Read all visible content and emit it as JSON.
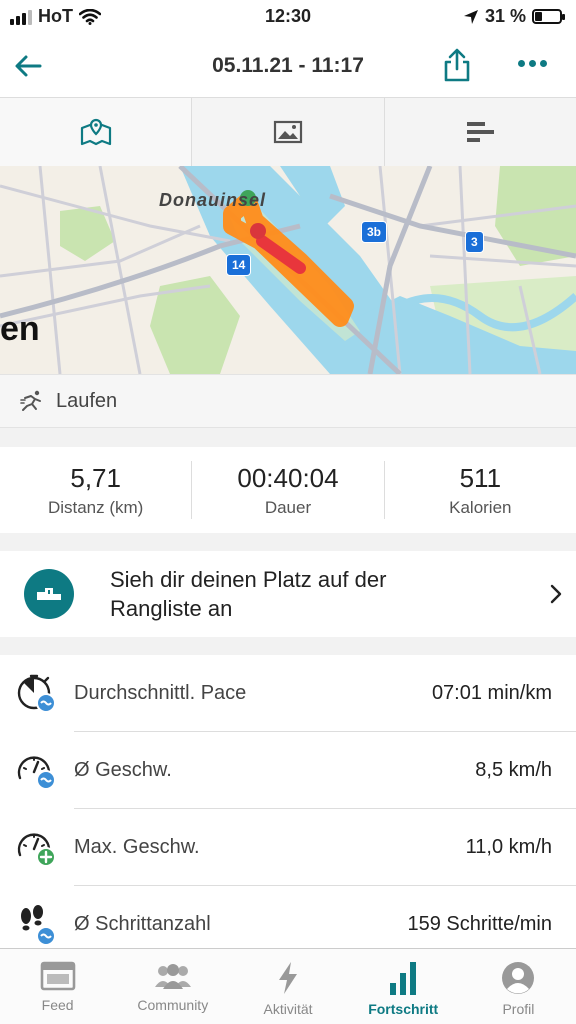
{
  "status_bar": {
    "carrier": "HoT",
    "time": "12:30",
    "battery": "31 %",
    "battery_level": 0.31
  },
  "header": {
    "title": "05.11.21 - 11:17"
  },
  "tabs": [
    {
      "icon": "map-icon",
      "active": true
    },
    {
      "icon": "photo-icon",
      "active": false
    },
    {
      "icon": "bar-chart-icon",
      "active": false
    }
  ],
  "map": {
    "place_label": "Donauinsel",
    "city_fragment": "en",
    "shields": [
      "3b",
      "3",
      "14"
    ]
  },
  "activity": {
    "icon": "running-icon",
    "name": "Laufen"
  },
  "stats": [
    {
      "value": "5,71",
      "label": "Distanz (km)"
    },
    {
      "value": "00:40:04",
      "label": "Dauer"
    },
    {
      "value": "511",
      "label": "Kalorien"
    }
  ],
  "leaderboard": {
    "text": "Sieh dir deinen Platz auf der Rangliste an"
  },
  "metrics": [
    {
      "icon": "stopwatch-icon",
      "name": "Durchschnittl. Pace",
      "value": "07:01 min/km"
    },
    {
      "icon": "speedometer-avg-icon",
      "name": "Ø Geschw.",
      "value": "8,5 km/h"
    },
    {
      "icon": "speedometer-max-icon",
      "name": "Max. Geschw.",
      "value": "11,0 km/h"
    },
    {
      "icon": "footsteps-icon",
      "name": "Ø Schrittanzahl",
      "value": "159 Schritte/min"
    }
  ],
  "tabbar": [
    {
      "label": "Feed",
      "icon": "feed-icon",
      "active": false
    },
    {
      "label": "Community",
      "icon": "community-icon",
      "active": false
    },
    {
      "label": "Aktivität",
      "icon": "lightning-icon",
      "active": false
    },
    {
      "label": "Fortschritt",
      "icon": "progress-icon",
      "active": true
    },
    {
      "label": "Profil",
      "icon": "profile-icon",
      "active": false
    }
  ],
  "colors": {
    "accent": "#0e7a83",
    "route_orange": "#ff8c1a",
    "route_red": "#e8363c",
    "water": "#9dd7ec"
  }
}
